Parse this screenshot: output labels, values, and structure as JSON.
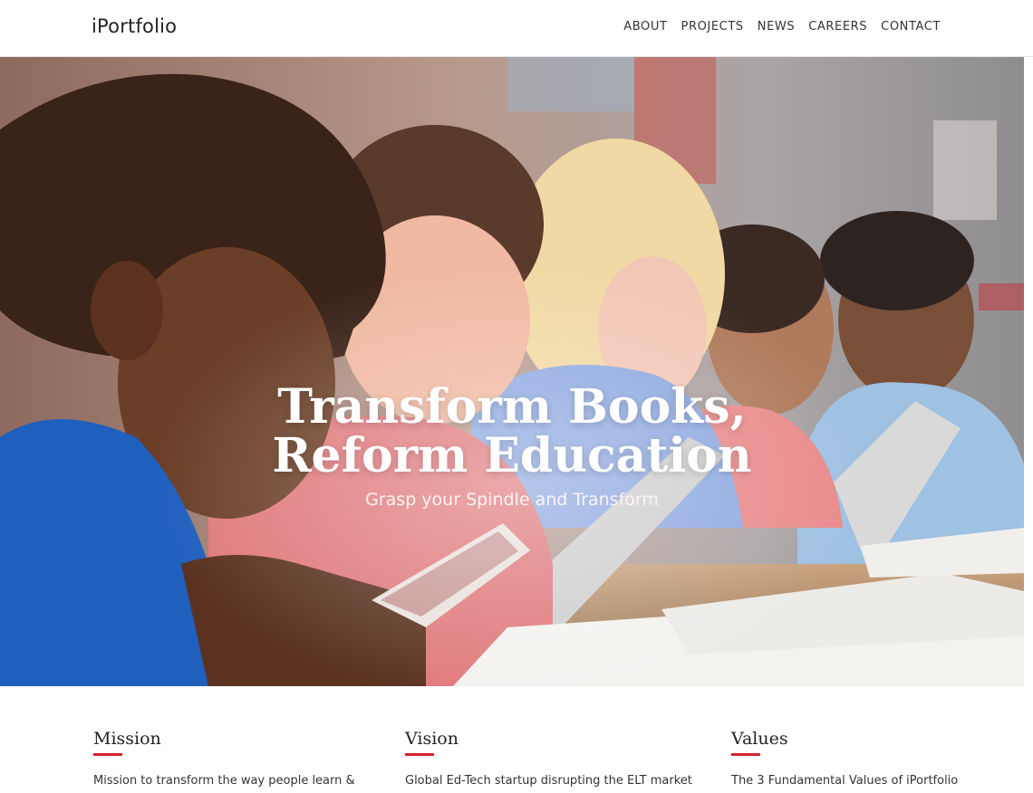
{
  "brand": {
    "name": "iPortfolio"
  },
  "nav": {
    "items": [
      "ABOUT",
      "PROJECTS",
      "NEWS",
      "CAREERS",
      "CONTACT"
    ]
  },
  "hero": {
    "title_line1": "Transform Books,",
    "title_line2": "Reform Education",
    "subtitle": "Grasp your Spindle and Transform"
  },
  "sections": [
    {
      "title": "Mission",
      "text": "Mission to transform the way people learn &"
    },
    {
      "title": "Vision",
      "text": "Global Ed-Tech startup disrupting the ELT market"
    },
    {
      "title": "Values",
      "text": "The 3 Fundamental Values of iPortfolio"
    }
  ],
  "colors": {
    "accent": "#d2232a"
  }
}
